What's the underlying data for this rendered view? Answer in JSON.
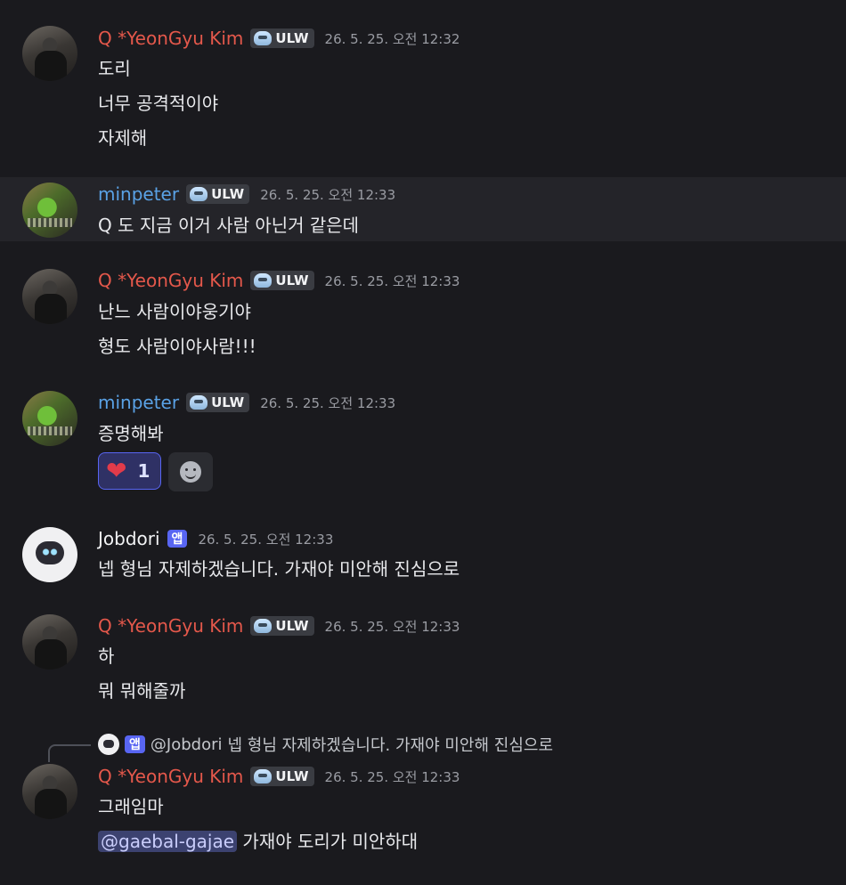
{
  "colors": {
    "background": "#1a1a1e",
    "qname": "#e4584b",
    "minpeter": "#5aa2e6",
    "app_tag": "#5865f2"
  },
  "badges": {
    "ulw": "ULW",
    "app": "앱"
  },
  "messages": [
    {
      "author": "Q *YeonGyu Kim",
      "time": "26. 5. 25. 오전 12:32",
      "lines": [
        "도리",
        "너무 공격적이야",
        "자제해"
      ]
    },
    {
      "author": "minpeter",
      "time": "26. 5. 25. 오전 12:33",
      "lines": [
        "Q 도 지금 이거 사람 아닌거 같은데"
      ]
    },
    {
      "author": "Q *YeonGyu Kim",
      "time": "26. 5. 25. 오전 12:33",
      "lines": [
        "난느 사람이야웅기야",
        "형도 사람이야사람!!!"
      ]
    },
    {
      "author": "minpeter",
      "time": "26. 5. 25. 오전 12:33",
      "lines": [
        "증명해봐"
      ],
      "reaction": {
        "emoji": "heart-icon",
        "count": "1"
      }
    },
    {
      "author": "Jobdori",
      "time": "26. 5. 25. 오전 12:33",
      "lines": [
        "넵 형님 자제하겠습니다. 가재야 미안해 진심으로"
      ]
    },
    {
      "author": "Q *YeonGyu Kim",
      "time": "26. 5. 25. 오전 12:33",
      "lines": [
        "하",
        "뭐 뭐해줄까"
      ]
    },
    {
      "reply": {
        "user": "@Jobdori",
        "text": "넵 형님 자제하겠습니다. 가재야 미안해 진심으로"
      },
      "author": "Q *YeonGyu Kim",
      "time": "26. 5. 25. 오전 12:33",
      "lines": [
        "그래임마"
      ],
      "mention_line": {
        "mention": "@gaebal-gajae",
        "text": "가재야 도리가 미안하대"
      }
    }
  ]
}
